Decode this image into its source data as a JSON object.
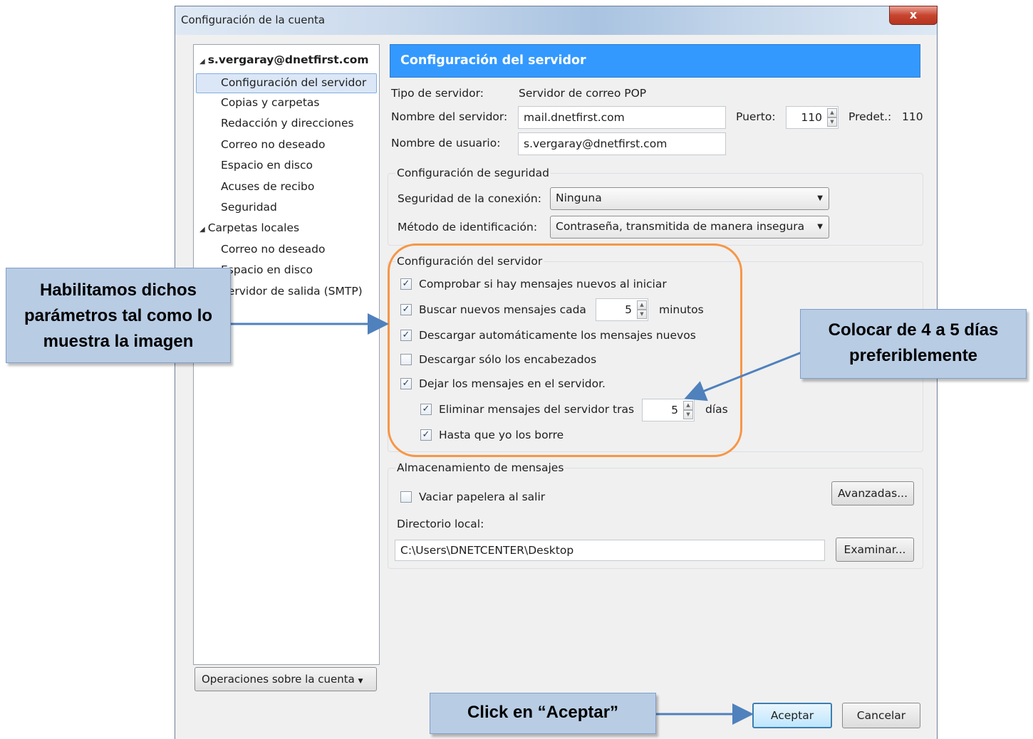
{
  "window": {
    "title": "Configuración de la cuenta",
    "close": "x"
  },
  "tree": {
    "account": "s.vergaray@dnetfirst.com",
    "account_items": [
      "Configuración del servidor",
      "Copias y carpetas",
      "Redacción y direcciones",
      "Correo no deseado",
      "Espacio en disco",
      "Acuses de recibo",
      "Seguridad"
    ],
    "local": "Carpetas locales",
    "local_items": [
      "Correo no deseado",
      "Espacio en disco",
      "Servidor de salida (SMTP)"
    ]
  },
  "account_ops": "Operaciones sobre la cuenta",
  "header": "Configuración del servidor",
  "server": {
    "type_label": "Tipo de servidor:",
    "type_value": "Servidor de correo POP",
    "name_label": "Nombre del servidor:",
    "name_value": "mail.dnetfirst.com",
    "port_label": "Puerto:",
    "port_value": "110",
    "default_label": "Predet.:",
    "default_value": "110",
    "user_label": "Nombre de usuario:",
    "user_value": "s.vergaray@dnetfirst.com"
  },
  "security": {
    "title": "Configuración de seguridad",
    "conn_label": "Seguridad de la conexión:",
    "conn_value": "Ninguna",
    "auth_label": "Método de identificación:",
    "auth_value": "Contraseña, transmitida de manera insegura"
  },
  "settings": {
    "title": "Configuración del servidor",
    "check_startup": "Comprobar si hay mensajes nuevos al iniciar",
    "check_every": "Buscar nuevos mensajes cada",
    "check_every_value": "5",
    "minutes": "minutos",
    "auto_download": "Descargar automáticamente los mensajes nuevos",
    "headers_only": "Descargar sólo los encabezados",
    "leave_on_server": "Dejar los mensajes en el servidor.",
    "delete_after": "Eliminar mensajes del servidor tras",
    "delete_after_value": "5",
    "days": "días",
    "until_deleted": "Hasta que yo los borre"
  },
  "storage": {
    "title": "Almacenamiento de mensajes",
    "empty_trash": "Vaciar papelera al salir",
    "advanced": "Avanzadas...",
    "local_dir_label": "Directorio local:",
    "local_dir_value": "C:\\Users\\DNETCENTER\\Desktop",
    "browse": "Examinar..."
  },
  "buttons": {
    "ok": "Aceptar",
    "cancel": "Cancelar"
  },
  "callouts": {
    "enable": "Habilitamos dichos parámetros tal como lo muestra la imagen",
    "days": "Colocar de 4 a 5 días preferiblemente",
    "accept": "Click en “Aceptar”"
  },
  "colors": {
    "accent": "#3399ff",
    "highlight": "#f79646",
    "callout": "#b8cce4",
    "arrow": "#4f81bd"
  }
}
